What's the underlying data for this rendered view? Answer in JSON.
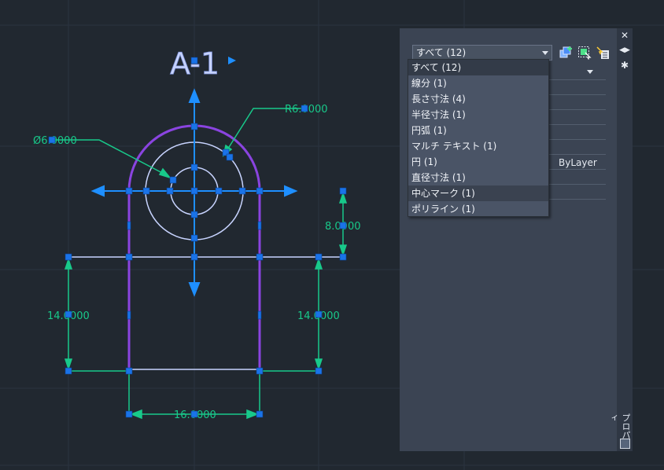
{
  "drawing": {
    "title": "A-1",
    "dimensions": {
      "radius": "R6.0000",
      "diameter": "Ø6.0000",
      "height_right": "8.0000",
      "left_height": "14.0000",
      "right_height": "14.0000",
      "bottom_width": "16.0000"
    }
  },
  "palette": {
    "selector": {
      "value": "すべて (12)"
    },
    "grid": {
      "visible_value": "ByLayer"
    },
    "side_title": "プロパティ",
    "tools": [
      "quick-select-icon",
      "select-objects-icon",
      "toggle-pickadd-icon"
    ]
  },
  "dropdown": {
    "items": [
      "すべて (12)",
      "線分 (1)",
      "長さ寸法 (4)",
      "半径寸法 (1)",
      "円弧 (1)",
      "マルチ テキスト (1)",
      "円 (1)",
      "直径寸法 (1)",
      "中心マーク (1)",
      "ポリライン (1)"
    ],
    "selected_index": 0,
    "hover_index": 8
  },
  "colors": {
    "background": "#212830",
    "grid": "#2b3340",
    "grip": "#1a73e8",
    "dimension": "#18c98a",
    "polyline": "#8a44e0",
    "circle": "#c8d4ff",
    "arrow": "#1e8fff"
  }
}
